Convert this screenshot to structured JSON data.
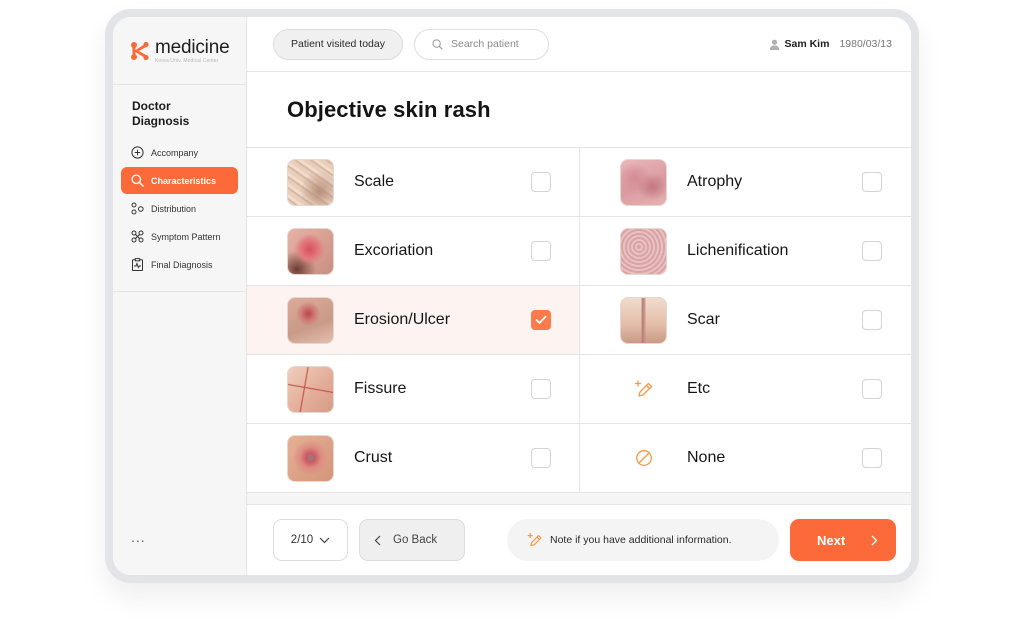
{
  "brand": {
    "name": "medicine",
    "subtitle": "Korea Univ. Medical Center",
    "accent_color": "#fd6a3a"
  },
  "sidebar": {
    "section_title": "Doctor Diagnosis",
    "items": [
      {
        "label": "Accompany",
        "icon": "plus-circle-icon",
        "active": false
      },
      {
        "label": "Characteristics",
        "icon": "search-icon",
        "active": true
      },
      {
        "label": "Distribution",
        "icon": "distribution-icon",
        "active": false
      },
      {
        "label": "Symptom Pattern",
        "icon": "pattern-icon",
        "active": false
      },
      {
        "label": "Final Diagnosis",
        "icon": "clipboard-icon",
        "active": false
      }
    ],
    "more_label": "..."
  },
  "topbar": {
    "visited_today_label": "Patient visited today",
    "search_placeholder": "Search patient",
    "user_name": "Sam Kim",
    "user_dob": "1980/03/13"
  },
  "main": {
    "title": "Objective skin rash",
    "options": [
      {
        "label": "Scale",
        "visual": "photo",
        "checked": false
      },
      {
        "label": "Atrophy",
        "visual": "photo",
        "checked": false
      },
      {
        "label": "Excoriation",
        "visual": "photo",
        "checked": false
      },
      {
        "label": "Lichenification",
        "visual": "photo",
        "checked": false
      },
      {
        "label": "Erosion/Ulcer",
        "visual": "photo",
        "checked": true
      },
      {
        "label": "Scar",
        "visual": "photo",
        "checked": false
      },
      {
        "label": "Fissure",
        "visual": "photo",
        "checked": false
      },
      {
        "label": "Etc",
        "visual": "pencil-plus-icon",
        "checked": false
      },
      {
        "label": "Crust",
        "visual": "photo",
        "checked": false
      },
      {
        "label": "None",
        "visual": "ban-icon",
        "checked": false
      }
    ]
  },
  "footer": {
    "page_indicator": "2/10",
    "go_back_label": "Go Back",
    "note_label": "Note if you have additional information.",
    "next_label": "Next"
  }
}
